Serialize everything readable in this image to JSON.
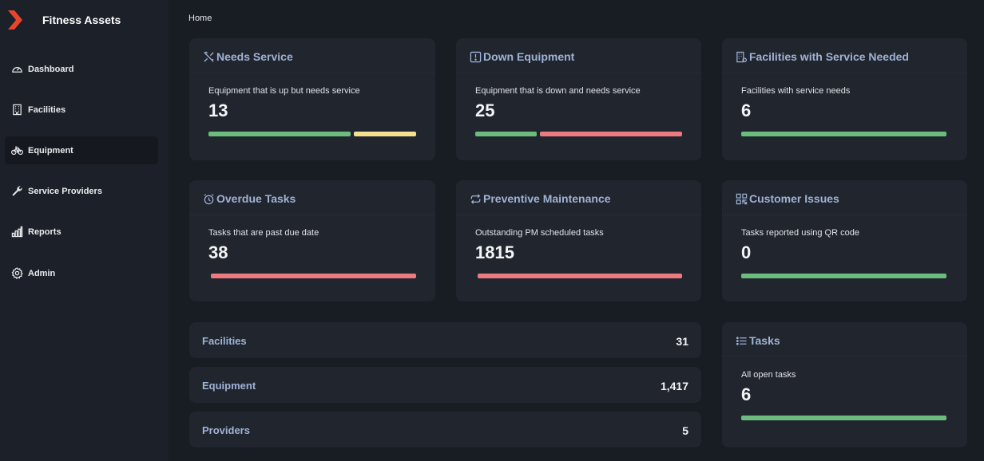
{
  "app": {
    "title": "Fitness Assets"
  },
  "sidebar": {
    "items": [
      {
        "label": "Dashboard",
        "icon": "dashboard-gauge-icon"
      },
      {
        "label": "Facilities",
        "icon": "building-icon"
      },
      {
        "label": "Equipment",
        "icon": "bicycle-icon",
        "active": true
      },
      {
        "label": "Service Providers",
        "icon": "wrench-icon"
      },
      {
        "label": "Reports",
        "icon": "bar-chart-icon"
      },
      {
        "label": "Admin",
        "icon": "gear-icon"
      }
    ]
  },
  "breadcrumb": "Home",
  "cards": {
    "needs_service": {
      "title": "Needs Service",
      "icon": "tools-icon",
      "description": "Equipment that is up but needs service",
      "value": "13"
    },
    "down_equipment": {
      "title": "Down Equipment",
      "icon": "exclamation-square-icon",
      "description": "Equipment that is down and needs service",
      "value": "25"
    },
    "facilities_service": {
      "title": "Facilities with Service Needed",
      "icon": "building-gear-icon",
      "description": "Facilities with service needs",
      "value": "6"
    },
    "overdue_tasks": {
      "title": "Overdue Tasks",
      "icon": "alarm-clock-icon",
      "description": "Tasks that are past due date",
      "value": "38"
    },
    "preventive_maintenance": {
      "title": "Preventive Maintenance",
      "icon": "repeat-icon",
      "description": "Outstanding PM scheduled tasks",
      "value": "1815"
    },
    "customer_issues": {
      "title": "Customer Issues",
      "icon": "qr-code-icon",
      "description": "Tasks reported using QR code",
      "value": "0"
    },
    "tasks": {
      "title": "Tasks",
      "icon": "list-icon",
      "description": "All open tasks",
      "value": "6"
    }
  },
  "summary": {
    "facilities": {
      "label": "Facilities",
      "value": "31"
    },
    "equipment": {
      "label": "Equipment",
      "value": "1,417"
    },
    "providers": {
      "label": "Providers",
      "value": "5"
    }
  },
  "colors": {
    "accent": "#e8452c",
    "title": "#9fb3d6",
    "green": "#6bbd7e",
    "yellow": "#f5e08f",
    "red": "#ee7a80"
  }
}
